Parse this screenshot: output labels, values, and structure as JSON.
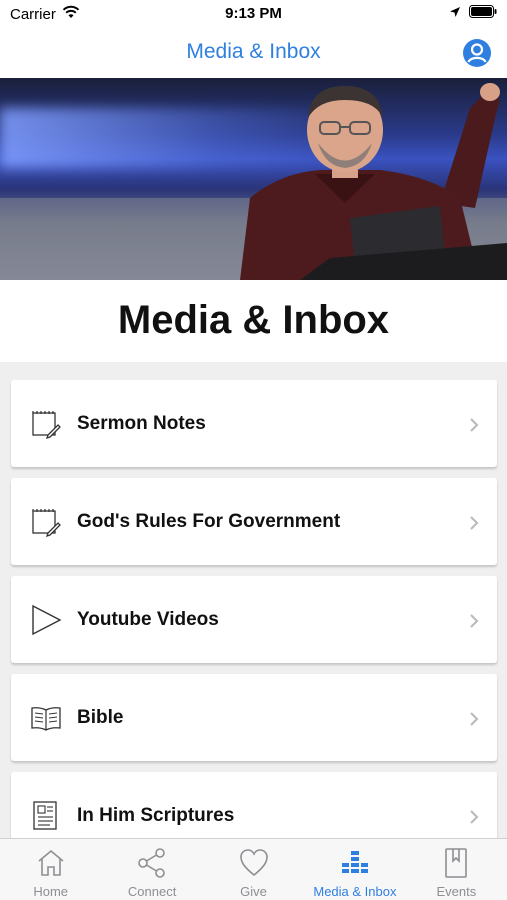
{
  "status_bar": {
    "carrier": "Carrier",
    "time": "9:13 PM"
  },
  "nav": {
    "title": "Media & Inbox",
    "profile_icon": "person-circle-icon"
  },
  "page": {
    "heading": "Media & Inbox"
  },
  "list": {
    "items": [
      {
        "label": "Sermon Notes",
        "icon": "notepad-edit-icon"
      },
      {
        "label": "God's Rules For Government",
        "icon": "notepad-edit-icon"
      },
      {
        "label": "Youtube Videos",
        "icon": "play-icon"
      },
      {
        "label": "Bible",
        "icon": "open-book-icon"
      },
      {
        "label": "In Him Scriptures",
        "icon": "document-icon"
      }
    ]
  },
  "tabs": [
    {
      "label": "Home",
      "icon": "home-icon",
      "active": false
    },
    {
      "label": "Connect",
      "icon": "share-icon",
      "active": false
    },
    {
      "label": "Give",
      "icon": "heart-icon",
      "active": false
    },
    {
      "label": "Media & Inbox",
      "icon": "media-bars-icon",
      "active": true
    },
    {
      "label": "Events",
      "icon": "bookmark-book-icon",
      "active": false
    }
  ],
  "colors": {
    "accent": "#2f7fe0",
    "inactive_tab": "#8e8e93",
    "background": "#efefef"
  }
}
